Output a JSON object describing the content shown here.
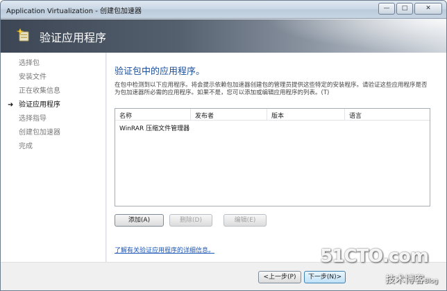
{
  "window": {
    "title": "Application Virtualization - 创建包加速器",
    "caption_buttons": {
      "minimize": "—",
      "maximize": "□",
      "close": "✕"
    }
  },
  "banner": {
    "heading": "验证应用程序",
    "icon": "wizard-sparkle-icon"
  },
  "sidebar": {
    "items": [
      {
        "label": "选择包",
        "active": false
      },
      {
        "label": "安装文件",
        "active": false
      },
      {
        "label": "正在收集信息",
        "active": false
      },
      {
        "label": "验证应用程序",
        "active": true
      },
      {
        "label": "选择指导",
        "active": false
      },
      {
        "label": "创建包加速器",
        "active": false
      },
      {
        "label": "完成",
        "active": false
      }
    ],
    "active_marker": "➜"
  },
  "main": {
    "subtitle": "验证包中的应用程序。",
    "description": "在包中检测到以下应用程序。将会提示依赖包加速器创建包的管理员提供这些特定的安装程序。请验证这些应用程序是否为包加速器所必需的应用程序。如果不是，您可以添加或编辑应用程序的列表。(T)",
    "list": {
      "columns": [
        "名称",
        "发布者",
        "版本",
        "语言"
      ],
      "rows": [
        {
          "name": "WinRAR 压缩文件管理器",
          "publisher": "",
          "version": "",
          "language": ""
        }
      ]
    },
    "buttons": {
      "add": "添加(A)",
      "remove": "删除(D)",
      "edit": "编辑(E)"
    },
    "link": "了解有关验证应用程序的详细信息。"
  },
  "footer": {
    "back": "<上一步(P)",
    "next": "下一步(N)>"
  },
  "watermark": {
    "site": "51CTO.com",
    "line2": "技术博客",
    "line2_suffix": "Blog"
  },
  "colors": {
    "accent_text": "#1a4e9c",
    "link": "#1a56b8",
    "banner_dark": "#3c4654"
  }
}
